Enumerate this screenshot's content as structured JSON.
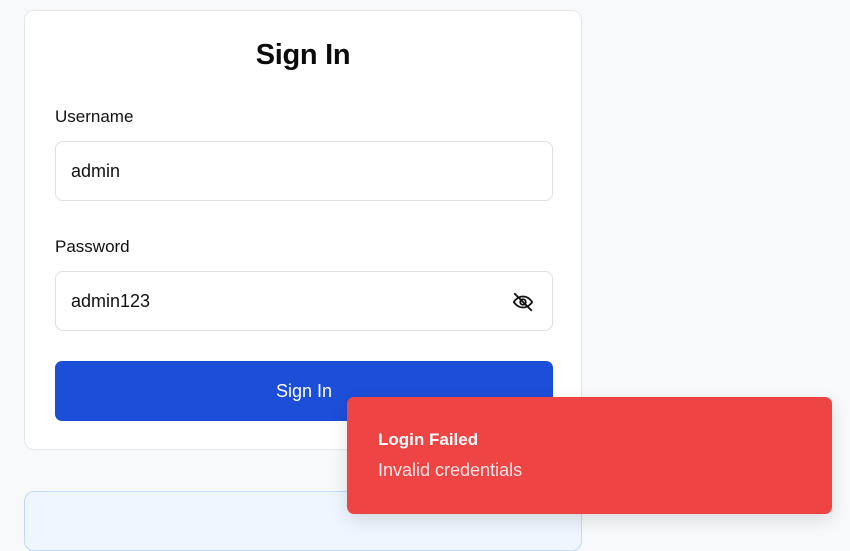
{
  "login_form": {
    "title": "Sign In",
    "username_label": "Username",
    "username_value": "admin",
    "password_label": "Password",
    "password_value": "admin123",
    "password_visibility_icon": "eye-off-icon",
    "submit_label": "Sign In",
    "accent_color": "#1d4ed8"
  },
  "toast": {
    "title": "Login Failed",
    "message": "Invalid credentials",
    "color": "#ef4444"
  }
}
